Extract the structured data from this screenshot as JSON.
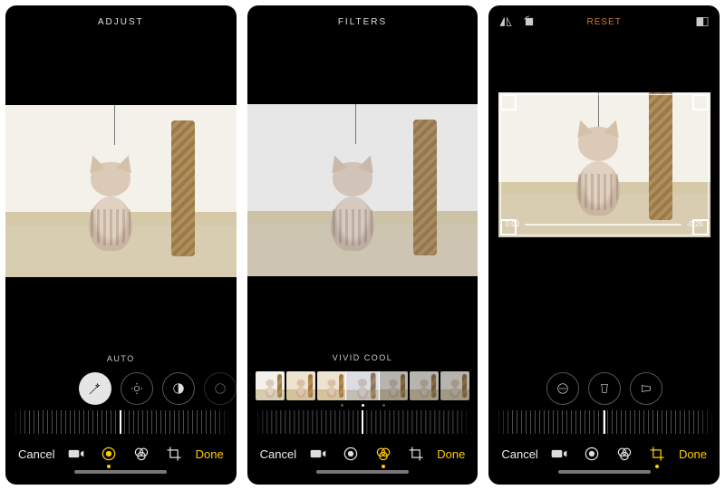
{
  "common": {
    "cancel": "Cancel",
    "done": "Done"
  },
  "panel_a": {
    "header_title": "ADJUST",
    "mode_label": "AUTO"
  },
  "panel_b": {
    "header_title": "FILTERS",
    "mode_label": "VIVID COOL",
    "selected_filter_index": 3
  },
  "panel_c": {
    "reset_label": "RESET",
    "time_start": "0:00",
    "time_end": "-0:25"
  }
}
